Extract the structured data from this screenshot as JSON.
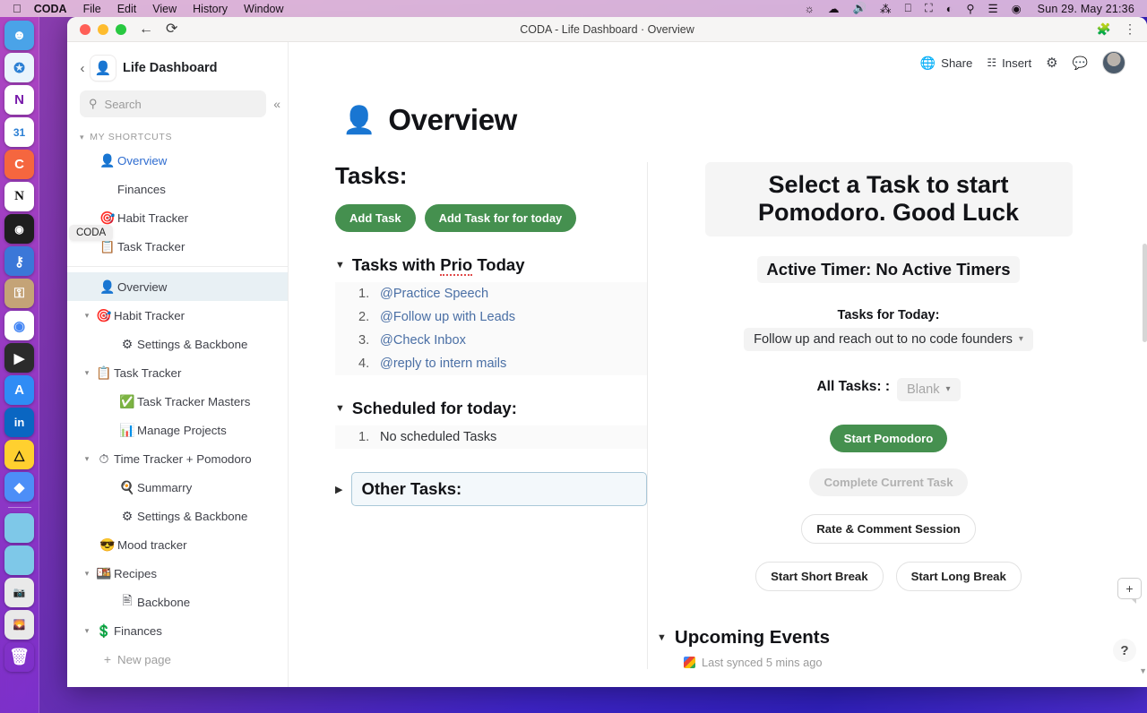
{
  "menubar": {
    "apple": "",
    "items": [
      {
        "label": "CODA",
        "bold": true
      },
      {
        "label": "File",
        "bold": false
      },
      {
        "label": "Edit",
        "bold": false
      },
      {
        "label": "View",
        "bold": false
      },
      {
        "label": "History",
        "bold": false
      },
      {
        "label": "Window",
        "bold": false
      }
    ],
    "status_icons": [
      "brightness-icon",
      "warning-cloud-icon",
      "volume-icon",
      "bluetooth-icon",
      "display-icon",
      "battery-charging-icon",
      "wifi-icon",
      "spotlight-search-icon",
      "control-center-icon",
      "siri-icon"
    ],
    "clock": "Sun 29. May  21:36"
  },
  "dock": {
    "apps": [
      {
        "name": "finder",
        "glyph": "🙂",
        "bg": "#4aa3e8",
        "running": true
      },
      {
        "name": "safari",
        "glyph": "🧭",
        "bg": "#e8f3fb",
        "running": true
      },
      {
        "name": "onenote",
        "glyph": "N",
        "bg": "#7719aa",
        "running": false
      },
      {
        "name": "google-calendar",
        "glyph": "31",
        "bg": "#ffffff",
        "running": false
      },
      {
        "name": "coda",
        "glyph": "C",
        "bg": "#f5663f",
        "running": true
      },
      {
        "name": "notion",
        "glyph": "N",
        "bg": "#ffffff",
        "running": false
      },
      {
        "name": "figma",
        "glyph": "◆",
        "bg": "#1e1e1e",
        "running": true
      },
      {
        "name": "1password",
        "glyph": "🔐",
        "bg": "#3b77d8",
        "running": false
      },
      {
        "name": "keychain",
        "glyph": "🗝",
        "bg": "#c4a377",
        "running": false
      },
      {
        "name": "chrome",
        "glyph": "◉",
        "bg": "#ffffff",
        "running": true
      },
      {
        "name": "quicktime",
        "glyph": "▶",
        "bg": "#2b2b2b",
        "running": true
      },
      {
        "name": "app-store",
        "glyph": "A",
        "bg": "#2f8cf5",
        "running": false
      },
      {
        "name": "linkedin",
        "glyph": "in",
        "bg": "#0a66c2",
        "running": true
      },
      {
        "name": "miro",
        "glyph": "𝕄",
        "bg": "#ffd02f",
        "running": true
      },
      {
        "name": "superhuman",
        "glyph": "◆",
        "bg": "#4d8ef7",
        "running": true
      }
    ],
    "files": [
      {
        "name": "downloads-folder",
        "glyph": "📁",
        "bg": "#7ec8e8"
      },
      {
        "name": "documents-folder",
        "glyph": "📁",
        "bg": "#7ec8e8"
      },
      {
        "name": "screenshots-stack",
        "glyph": "🖼",
        "bg": "#e9e9e9"
      },
      {
        "name": "wallpapers-stack",
        "glyph": "🏞",
        "bg": "#e9e9e9"
      },
      {
        "name": "trash",
        "glyph": "🗑",
        "bg": "transparent"
      }
    ]
  },
  "window": {
    "title": "CODA - Life Dashboard · Overview",
    "nav_back_icon": "back-arrow-icon",
    "nav_reload_icon": "reload-icon",
    "extensions_icon": "puzzle-icon",
    "menu_icon": "kebab-menu-icon"
  },
  "sidebar": {
    "doc_title": "Life Dashboard",
    "doc_icon": "person-avatar-icon",
    "back_chevron": "‹",
    "search": {
      "placeholder": "Search",
      "value": "",
      "icon": "search-icon"
    },
    "collapse_icon": "«",
    "section_label": "MY SHORTCUTS",
    "coda_tooltip": "CODA",
    "shortcuts": [
      {
        "label": "Overview",
        "icon": "👤",
        "style": "blue",
        "indent": 1
      },
      {
        "label": "Finances",
        "icon": "",
        "style": "normal",
        "indent": 1
      },
      {
        "label": "Habit Tracker",
        "icon": "🎯",
        "style": "normal",
        "indent": 1
      },
      {
        "label": "Task Tracker",
        "icon": "📋",
        "style": "normal",
        "indent": 1
      }
    ],
    "pages": [
      {
        "label": "Overview",
        "icon": "👤",
        "indent": 1,
        "chevron": "",
        "active": true
      },
      {
        "label": "Habit Tracker",
        "icon": "🎯",
        "indent": 0,
        "chevron": "⌄",
        "active": false
      },
      {
        "label": "Settings & Backbone",
        "icon": "⚙️",
        "indent": 1,
        "chevron": "",
        "active": false
      },
      {
        "label": "Task Tracker",
        "icon": "📋",
        "indent": 0,
        "chevron": "⌄",
        "active": false
      },
      {
        "label": "Task Tracker Masters",
        "icon": "✅",
        "indent": 1,
        "chevron": "",
        "active": false
      },
      {
        "label": "Manage Projects",
        "icon": "📊",
        "indent": 1,
        "chevron": "",
        "active": false
      },
      {
        "label": "Time Tracker + Pomodoro",
        "icon": "⏱️",
        "indent": 0,
        "chevron": "⌄",
        "active": false
      },
      {
        "label": "Summarry",
        "icon": "🥧",
        "indent": 1,
        "chevron": "",
        "active": false
      },
      {
        "label": "Settings & Backbone",
        "icon": "⚙️",
        "indent": 1,
        "chevron": "",
        "active": false
      },
      {
        "label": "Mood tracker",
        "icon": "😎",
        "indent": 0,
        "chevron": "",
        "active": false
      },
      {
        "label": "Recipes",
        "icon": "🍱",
        "indent": 0,
        "chevron": "⌄",
        "active": false
      },
      {
        "label": "Backbone",
        "icon": "📄",
        "indent": 1,
        "chevron": "",
        "active": false
      },
      {
        "label": "Finances",
        "icon": "💲",
        "indent": 0,
        "chevron": "⌄",
        "active": false
      }
    ],
    "new_page": {
      "label": "New page",
      "icon": "+"
    }
  },
  "topbar": {
    "share": {
      "label": "Share",
      "icon": "globe-icon"
    },
    "insert": {
      "label": "Insert",
      "icon": "grid-icon"
    },
    "settings_icon": "gear-icon",
    "comment_icon": "comment-icon",
    "avatar": "user-avatar"
  },
  "page": {
    "emoji": "👤",
    "title": "Overview"
  },
  "tasks_panel": {
    "heading": "Tasks:",
    "add_task": "Add Task",
    "add_task_today": "Add Task for for today",
    "prio_section": {
      "title_before": "Tasks with ",
      "title_spell": "Prio",
      "title_after": " Today",
      "items": [
        {
          "num": "1.",
          "label": "@Practice Speech"
        },
        {
          "num": "2.",
          "label": "@Follow up with Leads"
        },
        {
          "num": "3.",
          "label": "@Check Inbox"
        },
        {
          "num": "4.",
          "label": "@reply to intern mails"
        }
      ]
    },
    "scheduled_section": {
      "title": "Scheduled for today:",
      "items": [
        {
          "num": "1.",
          "label": "No scheduled Tasks"
        }
      ]
    },
    "other_tasks": {
      "title": "Other Tasks:",
      "collapsed": true
    }
  },
  "pomodoro_panel": {
    "banner": "Select a Task to start Pomodoro. Good Luck",
    "active_timer": "Active Timer: No Active Timers",
    "tasks_today_label": "Tasks for Today:",
    "tasks_today_value": "Follow up and reach out to no code founders",
    "all_tasks_label": "All Tasks: :",
    "all_tasks_value": "Blank",
    "buttons": {
      "start_pomodoro": "Start Pomodoro",
      "complete_current": "Complete Current Task",
      "rate_comment": "Rate & Comment Session",
      "short_break": "Start Short Break",
      "long_break": "Start Long Break"
    },
    "upcoming_events": {
      "title": "Upcoming Events",
      "synced": "Last synced 5 mins ago",
      "synced_icon": "google-calendar-icon"
    }
  },
  "floating": {
    "add_comment_icon": "+",
    "help_icon": "?"
  },
  "colors": {
    "accent_green": "#45904f",
    "link_blue": "#4a6fa5",
    "selection_border": "#aac8d8"
  }
}
